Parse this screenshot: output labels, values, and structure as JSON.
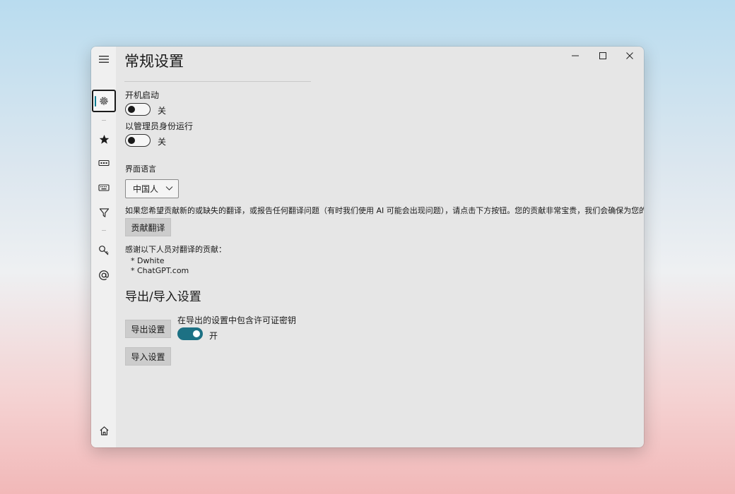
{
  "page": {
    "title": "常规设置",
    "section_export": "导出/导入设置"
  },
  "icons": {
    "menu": "hamburger-icon",
    "settings": "gear-icon",
    "star": "star-icon",
    "keyboard": "keyboard-icon",
    "filter": "filter-icon",
    "key": "key-icon",
    "at": "at-icon",
    "home": "home-icon"
  },
  "settings": {
    "startup": {
      "label": "开机启动",
      "state": "关"
    },
    "admin": {
      "label": "以管理员身份运行",
      "state": "关"
    },
    "language": {
      "label": "界面语言",
      "selected": "中国人"
    },
    "translate_note": "如果您希望贡献新的或缺失的翻译，或报告任何翻译问题（有时我们使用 AI 可能会出现问题），请点击下方按钮。您的贡献非常宝贵，我们会确保为您的贡",
    "contribute_button": "贡献翻译",
    "thanks_label": "感谢以下人员对翻译的贡献：",
    "contributors": [
      "* Dwhite",
      "* ChatGPT.com"
    ]
  },
  "export": {
    "export_button": "导出设置",
    "include_key_label": "在导出的设置中包含许可证密钥",
    "include_key_state": "开",
    "import_button": "导入设置"
  },
  "colors": {
    "accent": "#1d7184",
    "window_bg": "#e6e6e6"
  }
}
